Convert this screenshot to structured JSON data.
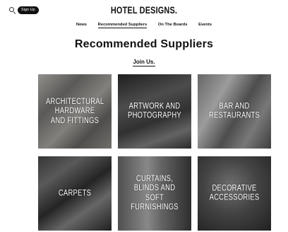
{
  "header": {
    "signup_label": "Sign Up",
    "logo_text": "HOTEL DESIGNS."
  },
  "nav": {
    "items": [
      {
        "label": "News",
        "active": false
      },
      {
        "label": "Recommended Suppliers",
        "active": true
      },
      {
        "label": "On The Boards",
        "active": false
      },
      {
        "label": "Events",
        "active": false
      }
    ]
  },
  "main": {
    "title": "Recommended Suppliers",
    "join_label": "Join Us."
  },
  "tiles": [
    {
      "label": "ARCHITECTURAL HARDWARE AND FITTINGS",
      "lines": [
        "ARCHITECTURAL",
        "HARDWARE",
        "AND FITTINGS"
      ]
    },
    {
      "label": "ARTWORK AND PHOTOGRAPHY",
      "lines": [
        "ARTWORK AND",
        "PHOTOGRAPHY"
      ]
    },
    {
      "label": "BAR AND RESTAURANTS",
      "lines": [
        "BAR AND",
        "RESTAURANTS"
      ]
    },
    {
      "label": "CARPETS",
      "lines": [
        "CARPETS"
      ]
    },
    {
      "label": "CURTAINS, BLINDS AND SOFT FURNISHINGS",
      "lines": [
        "CURTAINS,",
        "BLINDS AND",
        "SOFT FURNISHINGS"
      ]
    },
    {
      "label": "DECORATIVE ACCESSORIES",
      "lines": [
        "DECORATIVE",
        "ACCESSORIES"
      ]
    }
  ]
}
